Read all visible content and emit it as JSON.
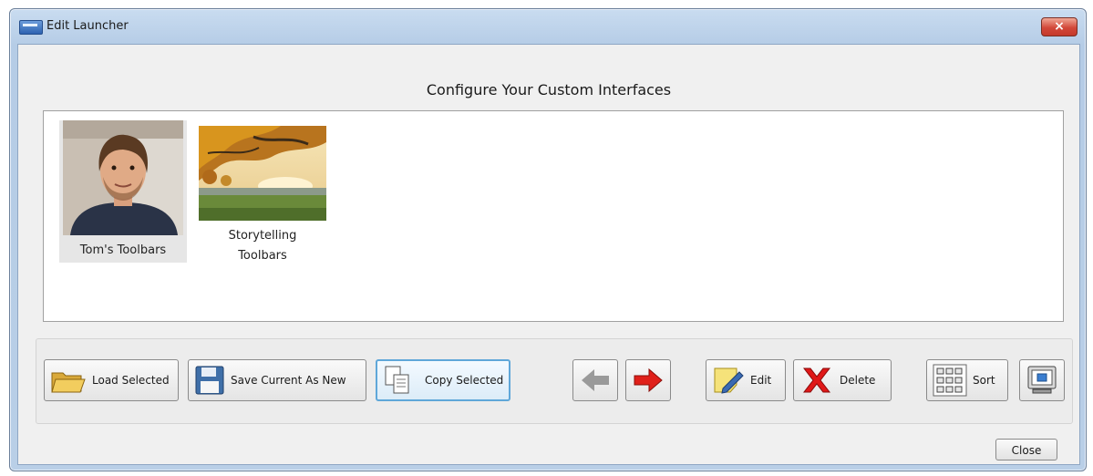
{
  "window": {
    "title": "Edit Launcher",
    "close_label": "×"
  },
  "heading": "Configure Your Custom Interfaces",
  "interfaces": [
    {
      "label": "Tom's Toolbars",
      "selected": true
    },
    {
      "label_line1": "Storytelling",
      "label_line2": "Toolbars",
      "selected": false
    }
  ],
  "toolbar": {
    "load_label": "Load Selected",
    "save_label": "Save Current As New",
    "copy_label": "Copy Selected",
    "edit_label": "Edit",
    "delete_label": "Delete",
    "sort_label": "Sort"
  },
  "footer": {
    "close_label": "Close"
  },
  "icons": {
    "load": "folder-open-icon",
    "save": "floppy-disk-icon",
    "copy": "copy-documents-icon",
    "move_left": "arrow-left-icon",
    "move_right": "arrow-right-icon",
    "edit": "pencil-note-icon",
    "delete": "red-x-icon",
    "sort": "grid-icon",
    "view": "monitor-icon"
  },
  "colors": {
    "accent_focus": "#5fa7d9",
    "arrow_right": "#e0201a",
    "arrow_left_disabled": "#9a9a9a"
  }
}
